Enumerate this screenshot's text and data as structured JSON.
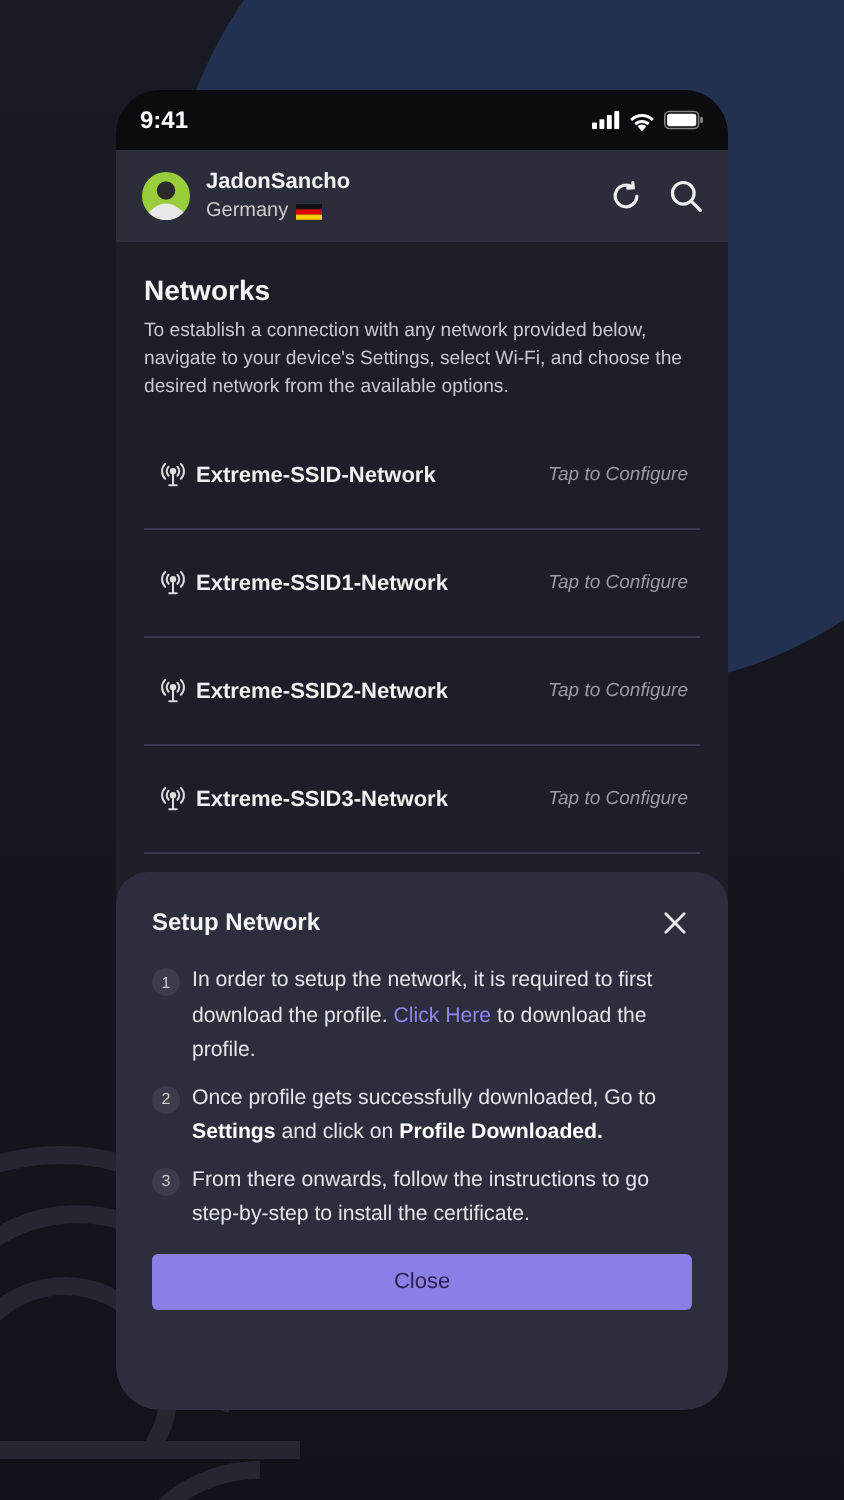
{
  "status_bar": {
    "time": "9:41"
  },
  "profile": {
    "name": "JadonSancho",
    "country": "Germany"
  },
  "networks": {
    "title": "Networks",
    "description": "To establish a connection with any network provided below, navigate to your device's Settings, select Wi-Fi, and choose the desired network from the available options.",
    "items": [
      {
        "name": "Extreme-SSID-Network",
        "action": "Tap to Configure"
      },
      {
        "name": "Extreme-SSID1-Network",
        "action": "Tap to Configure"
      },
      {
        "name": "Extreme-SSID2-Network",
        "action": "Tap to Configure"
      },
      {
        "name": "Extreme-SSID3-Network",
        "action": "Tap to Configure"
      }
    ]
  },
  "setup_sheet": {
    "title": "Setup Network",
    "steps": [
      {
        "number": "1",
        "text": "In order to setup the network, it is required to first download the profile.",
        "link": "Click Here",
        "text_after": "to download the profile."
      },
      {
        "number": "2",
        "text": "Once profile gets successfully downloaded, Go to **Settings** and click on **Profile Downloaded.**"
      },
      {
        "number": "3",
        "text": "From there onwards, follow the instructions to go step-by-step to install the certificate."
      }
    ],
    "button": "Close"
  }
}
